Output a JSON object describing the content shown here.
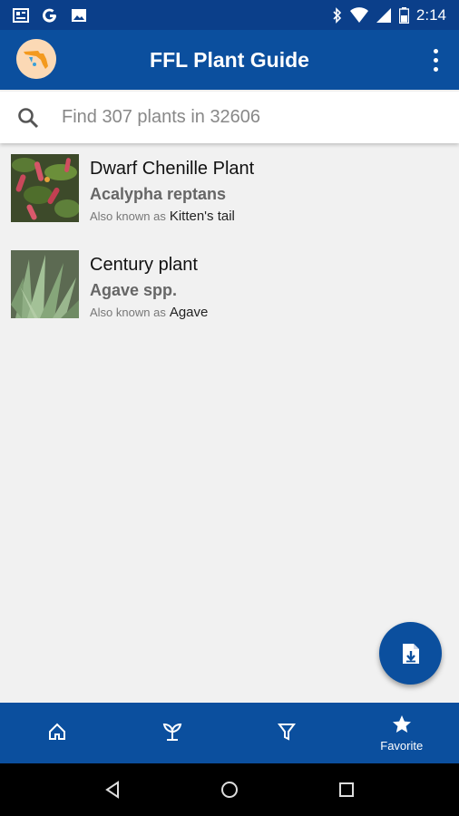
{
  "status_bar": {
    "time": "2:14",
    "left_icons": [
      "news-icon",
      "google-icon",
      "image-icon"
    ],
    "right_icons": [
      "bluetooth-icon",
      "wifi-icon",
      "signal-icon",
      "battery-icon"
    ]
  },
  "app_bar": {
    "title": "FFL Plant Guide",
    "logo_icon": "florida-logo-icon",
    "menu_icon": "more-vert-icon"
  },
  "search": {
    "placeholder": "Find 307 plants in 32606",
    "value": ""
  },
  "plants": [
    {
      "common_name": "Dwarf Chenille Plant",
      "scientific_name": "Acalypha reptans",
      "aka_prefix": "Also known as",
      "aka": "Kitten's tail"
    },
    {
      "common_name": "Century plant",
      "scientific_name": "Agave spp.",
      "aka_prefix": "Also known as",
      "aka": "Agave"
    }
  ],
  "fab": {
    "icon": "file-download-icon"
  },
  "bottom_nav": [
    {
      "icon": "home-icon",
      "label": ""
    },
    {
      "icon": "sprout-icon",
      "label": ""
    },
    {
      "icon": "filter-icon",
      "label": ""
    },
    {
      "icon": "star-icon",
      "label": "Favorite"
    }
  ],
  "system_nav": [
    "back-icon",
    "home-circle-icon",
    "recents-icon"
  ],
  "colors": {
    "primary": "#0b4f9e",
    "status_bar": "#0b3f8a",
    "background": "#f1f1f1"
  }
}
